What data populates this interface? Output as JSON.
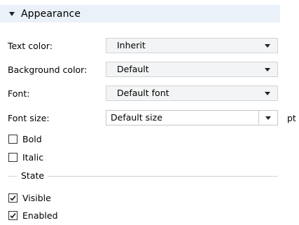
{
  "section": {
    "title": "Appearance"
  },
  "fields": [
    {
      "label": "Text color:",
      "value": "Inherit"
    },
    {
      "label": "Background color:",
      "value": "Default"
    },
    {
      "label": "Font:",
      "value": "Default font"
    }
  ],
  "font_size": {
    "label": "Font size:",
    "value": "Default size",
    "unit": "pt"
  },
  "checks": [
    {
      "label": "Bold",
      "checked": false
    },
    {
      "label": "Italic",
      "checked": false
    }
  ],
  "state": {
    "title": "State",
    "checks": [
      {
        "label": "Visible",
        "checked": true
      },
      {
        "label": "Enabled",
        "checked": true
      }
    ]
  }
}
